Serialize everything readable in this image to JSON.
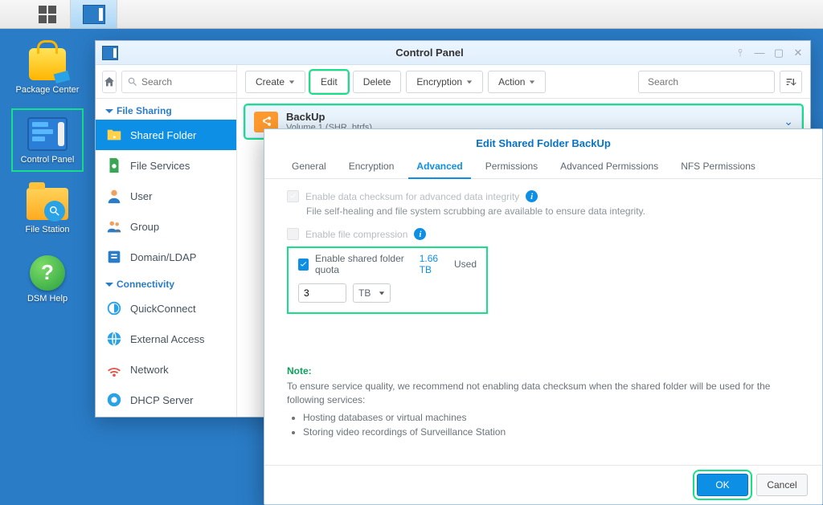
{
  "desktop": {
    "package_center": "Package Center",
    "control_panel": "Control Panel",
    "file_station": "File Station",
    "dsm_help": "DSM Help"
  },
  "control_panel": {
    "window_title": "Control Panel",
    "search_placeholder": "Search",
    "toolbar": {
      "create": "Create",
      "edit": "Edit",
      "delete": "Delete",
      "encryption": "Encryption",
      "action": "Action",
      "filter_placeholder": "Search"
    },
    "sidebar": {
      "section_file": "File Sharing",
      "items_file": [
        "Shared Folder",
        "File Services",
        "User",
        "Group",
        "Domain/LDAP"
      ],
      "section_conn": "Connectivity",
      "items_conn": [
        "QuickConnect",
        "External Access",
        "Network",
        "DHCP Server"
      ]
    },
    "row": {
      "name": "BackUp",
      "sub": "Volume 1 (SHR, btrfs)"
    }
  },
  "dialog": {
    "title": "Edit Shared Folder BackUp",
    "tabs": [
      "General",
      "Encryption",
      "Advanced",
      "Permissions",
      "Advanced Permissions",
      "NFS Permissions"
    ],
    "checksum_lbl": "Enable data checksum for advanced data integrity",
    "checksum_hint": "File self-healing and file system scrubbing are available to ensure data integrity.",
    "compress_lbl": "Enable file compression",
    "quota_lbl": "Enable shared folder quota",
    "quota_used_val": "1.66 TB",
    "quota_used_suffix": "Used",
    "quota_value": "3",
    "quota_unit": "TB",
    "note_title": "Note:",
    "note_text": "To ensure service quality, we recommend not enabling data checksum when the shared folder will be used for the following services:",
    "note_items": [
      "Hosting databases or virtual machines",
      "Storing video recordings of Surveillance Station"
    ],
    "ok": "OK",
    "cancel": "Cancel"
  }
}
